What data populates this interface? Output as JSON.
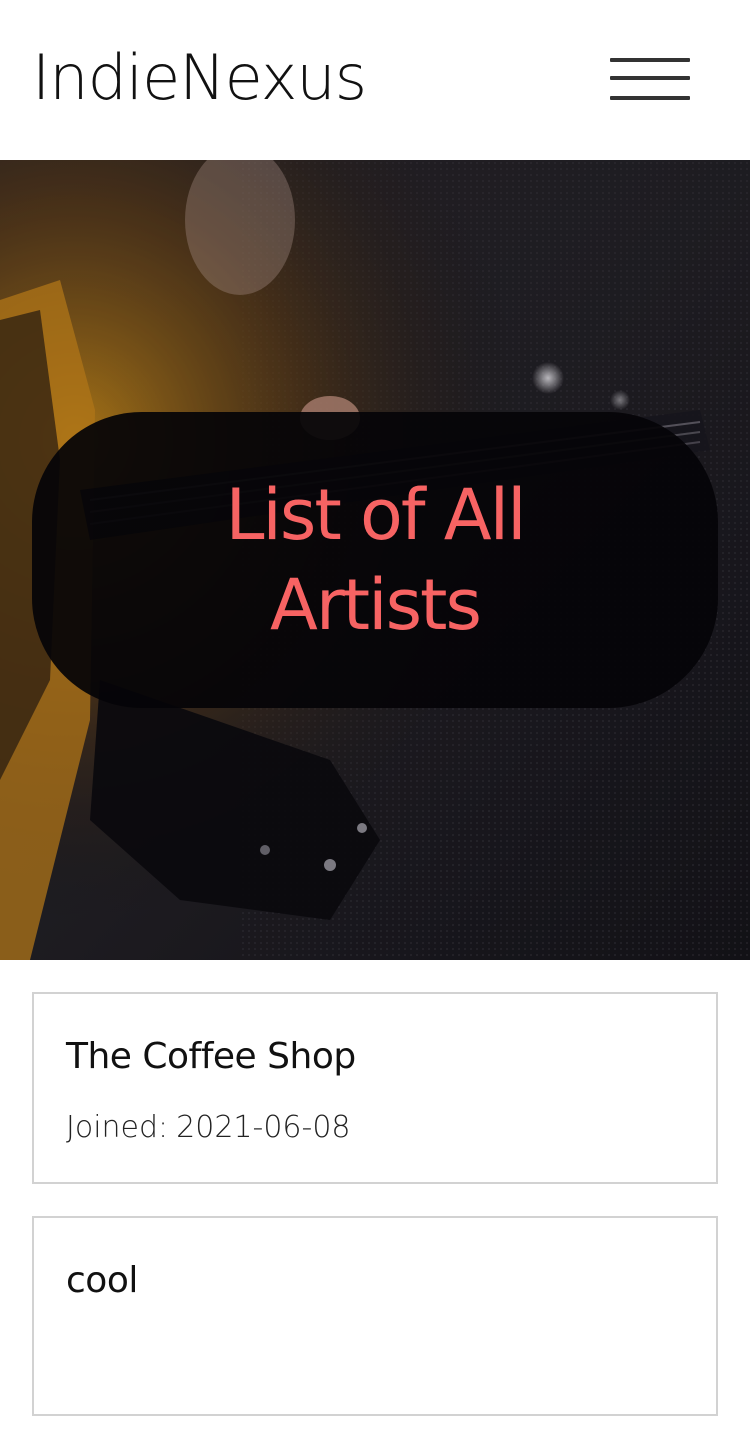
{
  "header": {
    "brand": "IndieNexus",
    "menu_icon": "hamburger-menu-icon"
  },
  "hero": {
    "title": "List of All Artists",
    "title_color": "#f76363",
    "background_image": "guitar-photo"
  },
  "artists": [
    {
      "name": "The Coffee Shop",
      "joined_label": "Joined:",
      "joined_date": "2021-06-08"
    },
    {
      "name": "cool"
    }
  ]
}
